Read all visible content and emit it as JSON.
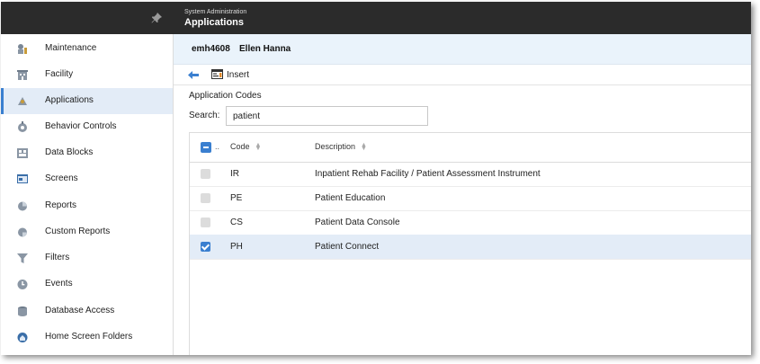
{
  "header": {
    "subtitle": "System Administration",
    "title": "Applications"
  },
  "sidebar": {
    "items": [
      {
        "label": "Maintenance",
        "icon": "maintenance-icon",
        "active": false
      },
      {
        "label": "Facility",
        "icon": "facility-icon",
        "active": false
      },
      {
        "label": "Applications",
        "icon": "applications-icon",
        "active": true
      },
      {
        "label": "Behavior Controls",
        "icon": "behavior-controls-icon",
        "active": false
      },
      {
        "label": "Data Blocks",
        "icon": "data-blocks-icon",
        "active": false
      },
      {
        "label": "Screens",
        "icon": "screens-icon",
        "active": false
      },
      {
        "label": "Reports",
        "icon": "reports-icon",
        "active": false
      },
      {
        "label": "Custom Reports",
        "icon": "custom-reports-icon",
        "active": false
      },
      {
        "label": "Filters",
        "icon": "filters-icon",
        "active": false
      },
      {
        "label": "Events",
        "icon": "events-icon",
        "active": false
      },
      {
        "label": "Database Access",
        "icon": "database-access-icon",
        "active": false
      },
      {
        "label": "Home Screen Folders",
        "icon": "home-screen-folders-icon",
        "active": false
      }
    ]
  },
  "user": {
    "id": "emh4608",
    "name": "Ellen Hanna"
  },
  "toolbar": {
    "insert_label": "Insert"
  },
  "main": {
    "section_title": "Application Codes",
    "search_label": "Search:",
    "search_value": "patient"
  },
  "grid": {
    "columns": {
      "more": "..",
      "code": "Code",
      "description": "Description"
    },
    "rows": [
      {
        "code": "IR",
        "description": "Inpatient Rehab Facility / Patient Assessment Instrument",
        "checked": false
      },
      {
        "code": "PE",
        "description": "Patient Education",
        "checked": false
      },
      {
        "code": "CS",
        "description": "Patient Data Console",
        "checked": false
      },
      {
        "code": "PH",
        "description": "Patient Connect",
        "checked": true
      }
    ]
  },
  "colors": {
    "topbar": "#2b2b2b",
    "accent": "#3a7fd0",
    "selected_row": "#e3ecf7",
    "user_bar": "#eaf3fb"
  }
}
